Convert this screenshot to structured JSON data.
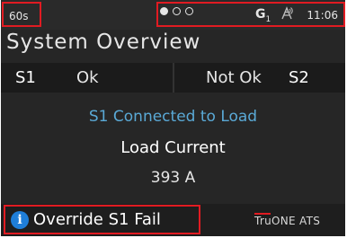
{
  "status_bar": {
    "timer": "60s",
    "page_dots": [
      "filled",
      "empty",
      "empty"
    ],
    "generator_icon": "generator-icon",
    "generator_label": "G",
    "generator_sub": "1",
    "signal_icon": "antenna-signal-icon",
    "clock": "11:06"
  },
  "page_title": "System Overview",
  "sources": {
    "s1": {
      "name": "S1",
      "status": "Ok"
    },
    "s2": {
      "name": "S2",
      "status": "Not Ok"
    }
  },
  "main": {
    "connection_status": "S1 Connected to Load",
    "load_label": "Load Current",
    "load_value": "393 A"
  },
  "bottom_bar": {
    "info_icon": "info-icon",
    "info_glyph": "i",
    "override_label": "Override S1 Fail",
    "brand": "TruONE ATS"
  },
  "colors": {
    "background": "#262626",
    "accent_blue": "#5aa9d6",
    "highlight_red": "#e11b22",
    "info_blue": "#1f7ed8"
  }
}
